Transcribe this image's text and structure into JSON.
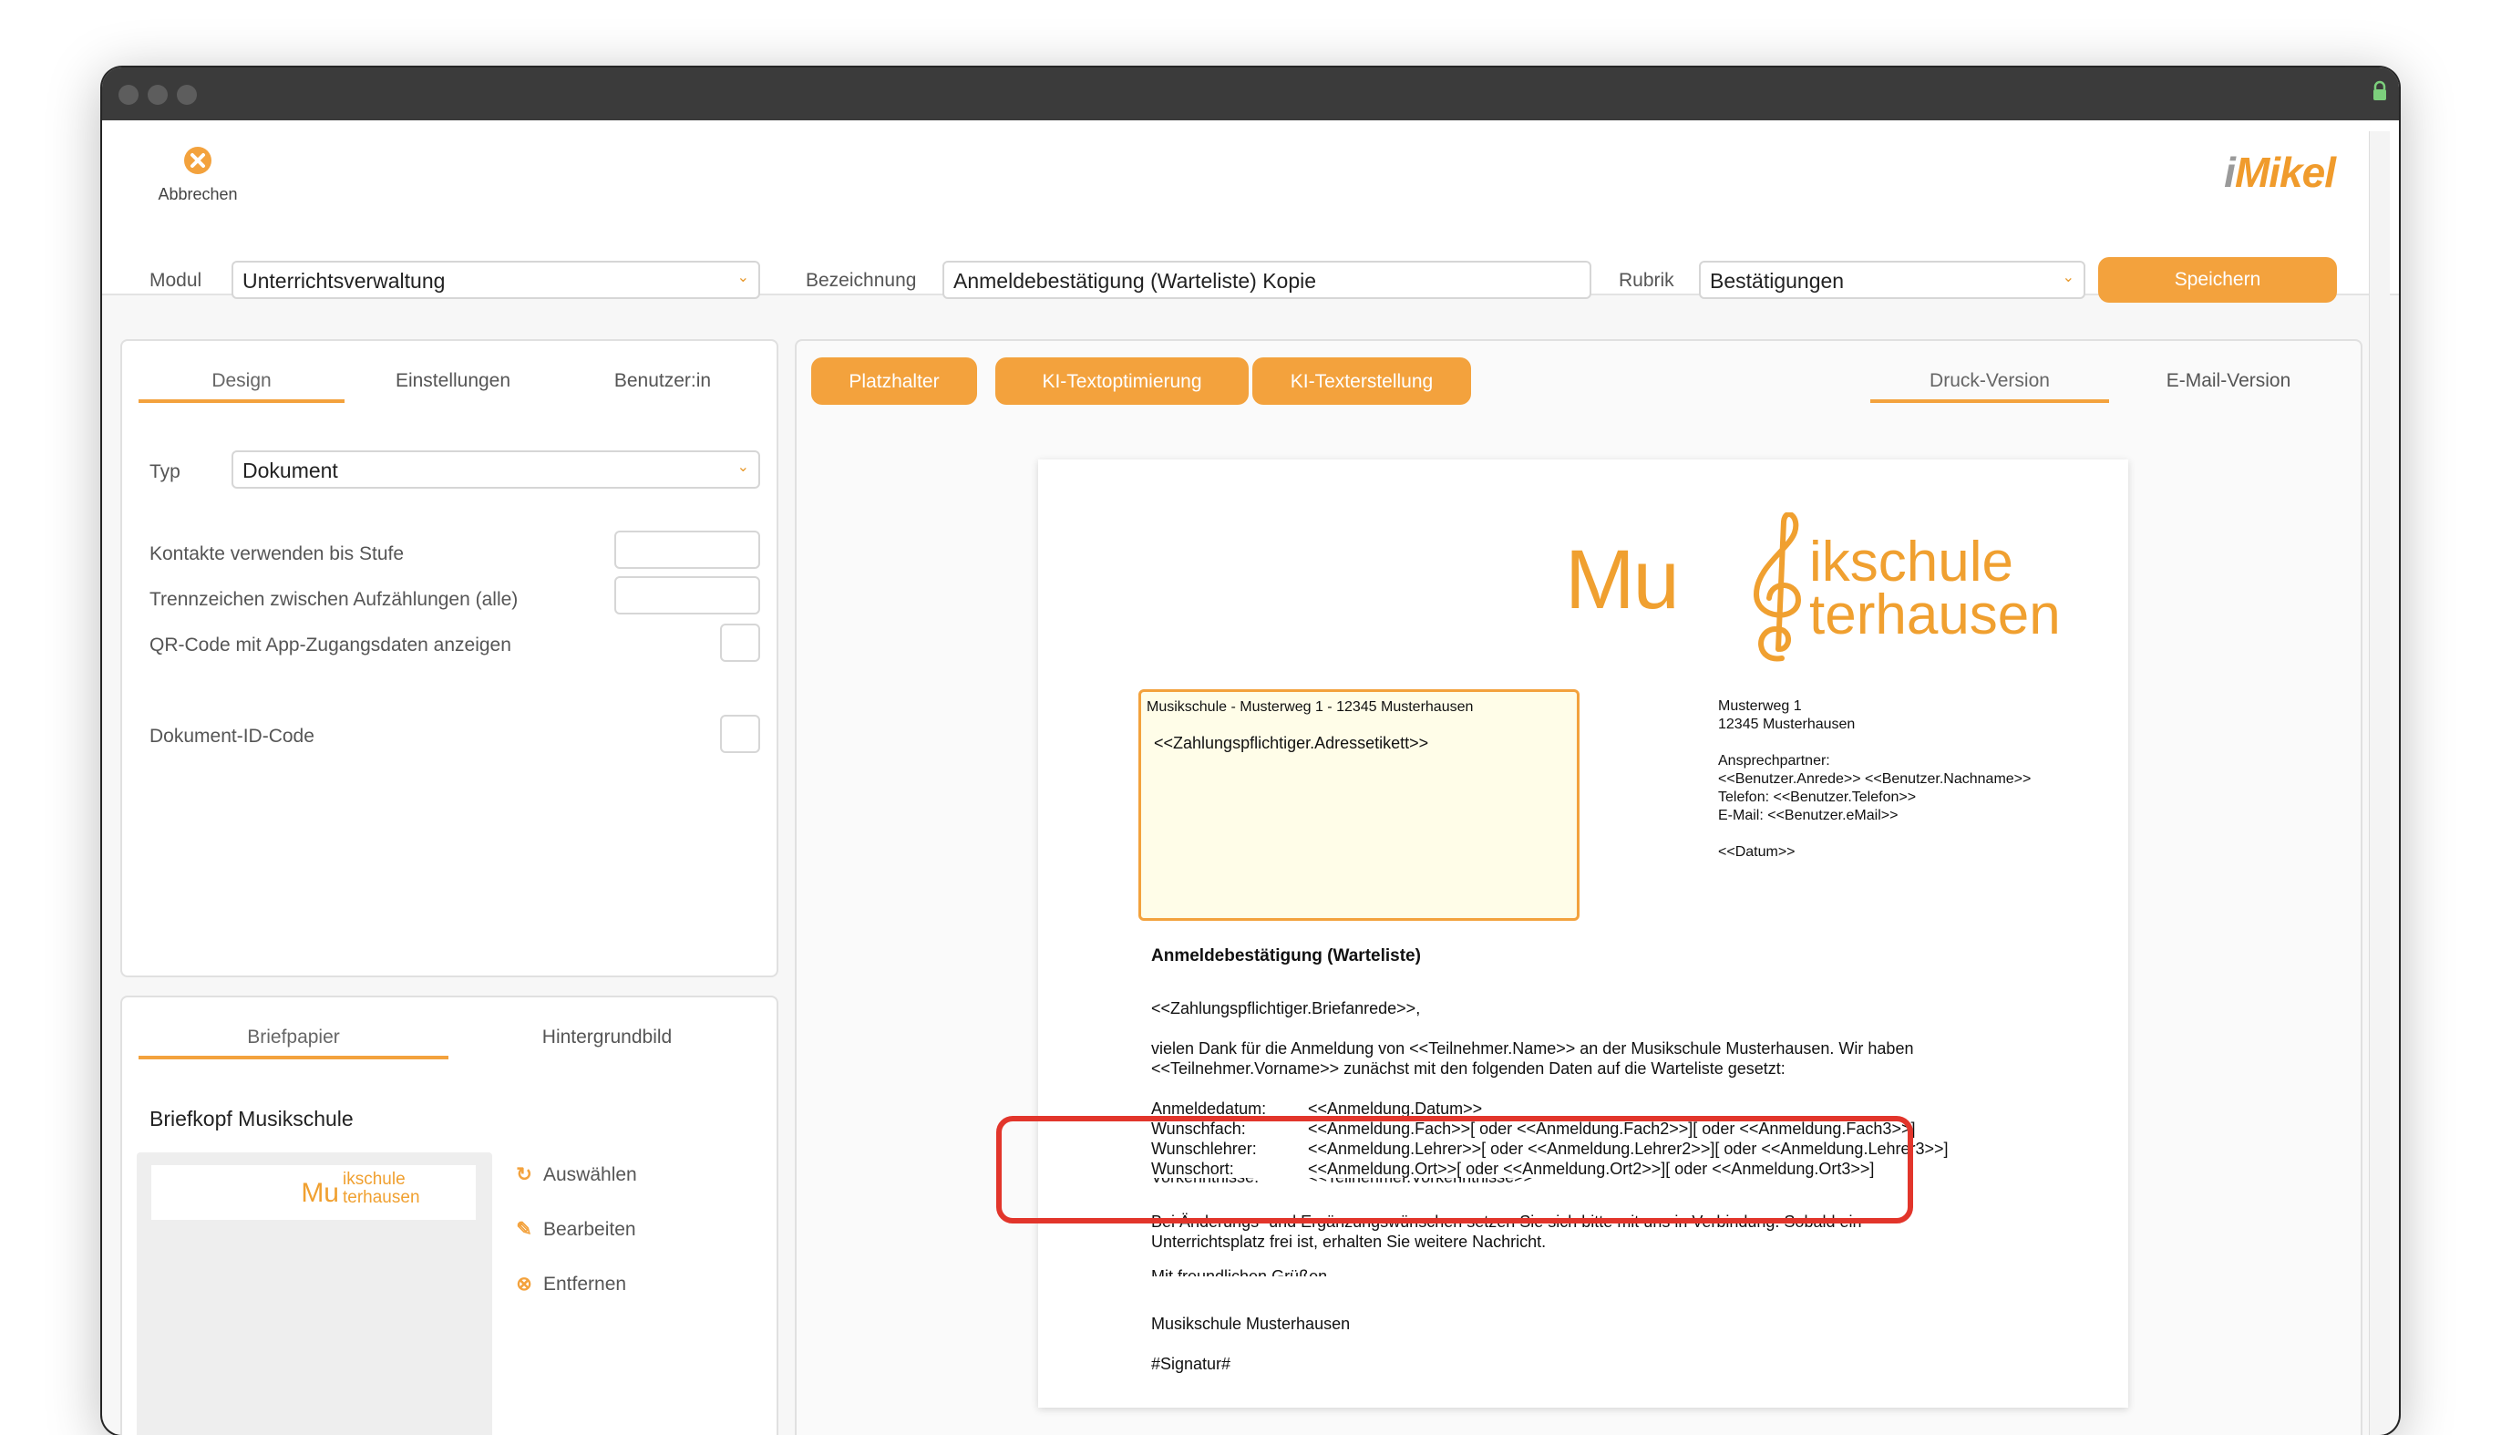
{
  "toolbar": {
    "abort_label": "Abbrechen",
    "logo": {
      "i": "i",
      "rest": "Mikel"
    }
  },
  "form": {
    "modul_label": "Modul",
    "modul_value": "Unterrichtsverwaltung",
    "bezeichnung_label": "Bezeichnung",
    "bezeichnung_value": "Anmeldebestätigung (Warteliste) Kopie",
    "rubrik_label": "Rubrik",
    "rubrik_value": "Bestätigungen",
    "save_label": "Speichern"
  },
  "left_panel": {
    "tabs": [
      "Design",
      "Einstellungen",
      "Benutzer:in"
    ],
    "typ_label": "Typ",
    "typ_value": "Dokument",
    "settings": [
      "Kontakte verwenden bis Stufe",
      "Trennzeichen zwischen Aufzählungen (alle)",
      "QR-Code mit App-Zugangsdaten anzeigen",
      "Dokument-ID-Code"
    ]
  },
  "letterhead_panel": {
    "tabs": [
      "Briefpapier",
      "Hintergrundbild"
    ],
    "title": "Briefkopf Musikschule",
    "thumb": {
      "line1": "ikschule",
      "line2": "terhausen",
      "prefix": "Mu"
    },
    "actions": [
      "Auswählen",
      "Bearbeiten",
      "Entfernen"
    ]
  },
  "editor": {
    "buttons": [
      "Platzhalter",
      "KI-Textoptimierung",
      "KI-Texterstellung"
    ],
    "version_tabs": [
      "Druck-Version",
      "E-Mail-Version"
    ]
  },
  "document": {
    "logo": {
      "prefix": "Mu",
      "line1": "ikschule",
      "line2": "terhausen"
    },
    "sender_line": "Musikschule - Musterweg 1 - 12345 Musterhausen",
    "address_placeholder": "<<Zahlungspflichtiger.Adressetikett>>",
    "info": [
      "Musterweg 1",
      "12345 Musterhausen",
      "",
      "Ansprechpartner:",
      "<<Benutzer.Anrede>> <<Benutzer.Nachname>>",
      "Telefon: <<Benutzer.Telefon>>",
      "E-Mail: <<Benutzer.eMail>>",
      "",
      "<<Datum>>"
    ],
    "subject": "Anmeldebestätigung (Warteliste)",
    "salutation": "<<Zahlungspflichtiger.Briefanrede>>,",
    "body1": "vielen Dank für die Anmeldung von <<Teilnehmer.Name>> an der Musikschule Musterhausen. Wir haben",
    "body2": "<<Teilnehmer.Vorname>> zunächst mit den folgenden Daten auf die Warteliste gesetzt:",
    "details": [
      {
        "k": "Anmeldedatum:",
        "v": "<<Anmeldung.Datum>>"
      },
      {
        "k": "Wunschfach:",
        "v": "<<Anmeldung.Fach>>[ oder <<Anmeldung.Fach2>>][ oder <<Anmeldung.Fach3>>]"
      },
      {
        "k": "Wunschlehrer:",
        "v": "<<Anmeldung.Lehrer>>[ oder <<Anmeldung.Lehrer2>>][ oder <<Anmeldung.Lehrer3>>]"
      },
      {
        "k": "Wunschort:",
        "v": "<<Anmeldung.Ort>>[ oder <<Anmeldung.Ort2>>][ oder <<Anmeldung.Ort3>>]"
      },
      {
        "k": "Vorkenntnisse:",
        "v": "<<Teilnehmer.Vorkenntnisse>>"
      }
    ],
    "change1": "Bei Änderungs- und Ergänzungswünschen setzen Sie sich bitte mit uns in Verbindung. Sobald ein",
    "change2": "Unterrichtsplatz frei ist, erhalten Sie weitere Nachricht.",
    "closing": "Mit freundlichen Grüßen",
    "signature_org": "Musikschule Musterhausen",
    "signature": "#Signatur#"
  },
  "colors": {
    "accent": "#f3a23d",
    "highlight": "#e2352b"
  }
}
